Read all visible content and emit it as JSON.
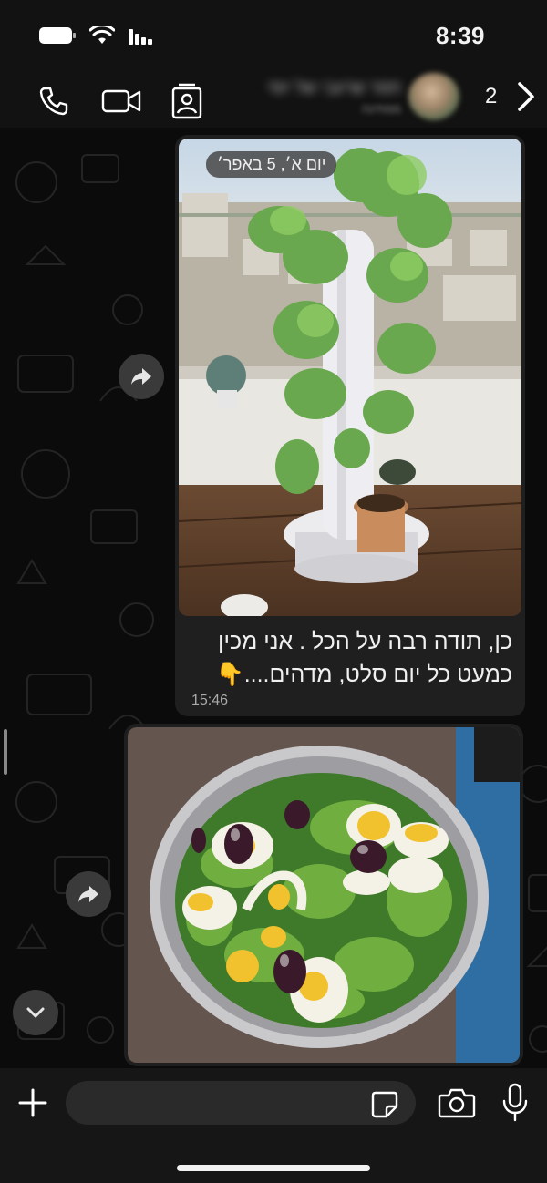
{
  "status_bar": {
    "time": "8:39"
  },
  "header": {
    "contact_name": "תמר שרעבי של יוסי",
    "contact_status": "ממתינה",
    "unread_count": "2"
  },
  "messages": [
    {
      "type": "image",
      "date_chip": "יום א׳, 5 באפר׳",
      "caption": "כן, תודה רבה על הכל . אני מכין כמעט כל יום סלט, מדהים....👇",
      "time": "15:46",
      "image_desc": "vertical-garden-tower"
    },
    {
      "type": "image",
      "image_desc": "egg-salad-bowl"
    }
  ],
  "composer": {
    "placeholder": ""
  },
  "colors": {
    "bubble": "#1f1f1f",
    "background": "#0b0b0b",
    "bar": "#121212"
  }
}
